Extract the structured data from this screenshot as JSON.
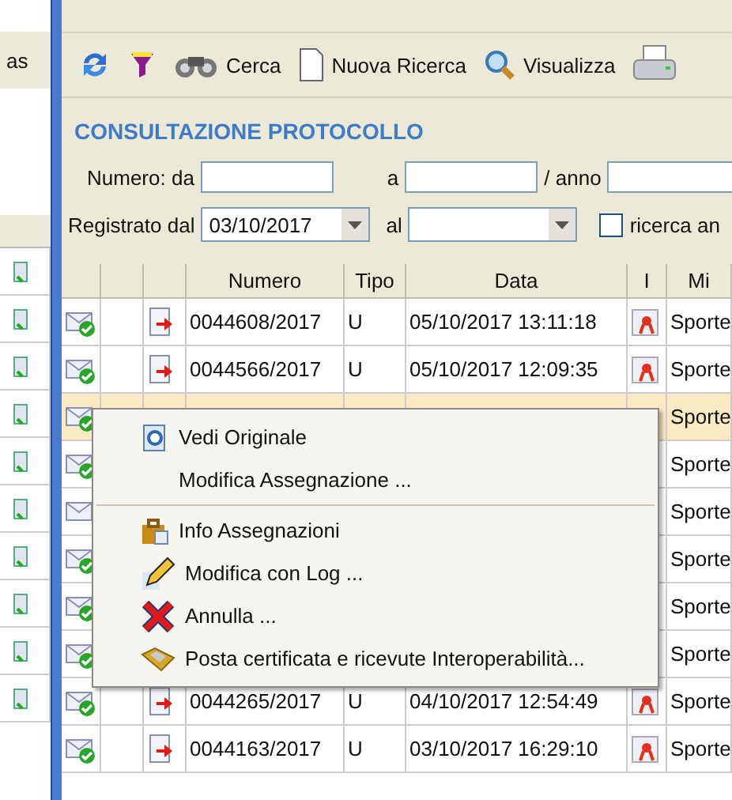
{
  "back_window": {
    "label": "as"
  },
  "toolbar": [
    {
      "kind": "refresh"
    },
    {
      "kind": "funnel"
    },
    {
      "kind": "binoculars",
      "label": "Cerca"
    },
    {
      "kind": "document",
      "label": "Nuova Ricerca"
    },
    {
      "kind": "magnifier",
      "label": "Visualizza"
    },
    {
      "kind": "printer"
    }
  ],
  "title": "CONSULTAZIONE PROTOCOLLO",
  "form": {
    "numero_label": "Numero: da",
    "a_label": "a",
    "anno_label": "/ anno",
    "registrato_label": "Registrato dal",
    "registrato_value": "03/10/2017",
    "al_label": "al",
    "ricerca_label": "ricerca an",
    "ricerca_checked": false
  },
  "table": {
    "columns": [
      "",
      "",
      "",
      "Numero",
      "Tipo",
      "Data",
      "I",
      "Mi"
    ],
    "rows": [
      {
        "kind": "checked",
        "selected": false,
        "numero": "0044608/2017",
        "tipo": "U",
        "data": "05/10/2017 13:11:18",
        "mittente": "Sporte"
      },
      {
        "kind": "checked",
        "selected": false,
        "numero": "0044566/2017",
        "tipo": "U",
        "data": "05/10/2017 12:09:35",
        "mittente": "Sporte"
      },
      {
        "kind": "checked",
        "selected": true,
        "mittente": "Sporte"
      },
      {
        "kind": "checked",
        "selected": false,
        "mittente": "Sporte"
      },
      {
        "kind": "plain",
        "selected": false,
        "mittente": "Sporte"
      },
      {
        "kind": "checked",
        "selected": false,
        "mittente": "Sporte"
      },
      {
        "kind": "checked",
        "selected": false,
        "mittente": "Sporte"
      },
      {
        "kind": "checked",
        "selected": false,
        "mittente": "Sporte"
      },
      {
        "kind": "checked",
        "selected": false,
        "numero": "0044265/2017",
        "tipo": "U",
        "data": "04/10/2017 12:54:49",
        "mittente": "Sporte"
      },
      {
        "kind": "checked",
        "selected": false,
        "numero": "0044163/2017",
        "tipo": "U",
        "data": "03/10/2017 16:29:10",
        "mittente": "Sporte"
      }
    ]
  },
  "context_menu": [
    {
      "kind": "preview",
      "label": "Vedi Originale"
    },
    {
      "kind": "none",
      "label": "Modifica Assegnazione ..."
    },
    {
      "kind": "separator"
    },
    {
      "kind": "briefcase",
      "label": "Info Assegnazioni"
    },
    {
      "kind": "pencil",
      "label": "Modifica con Log ..."
    },
    {
      "kind": "cross",
      "label": "Annulla ..."
    },
    {
      "kind": "tray",
      "label": "Posta certificata e ricevute Interoperabilità..."
    }
  ]
}
